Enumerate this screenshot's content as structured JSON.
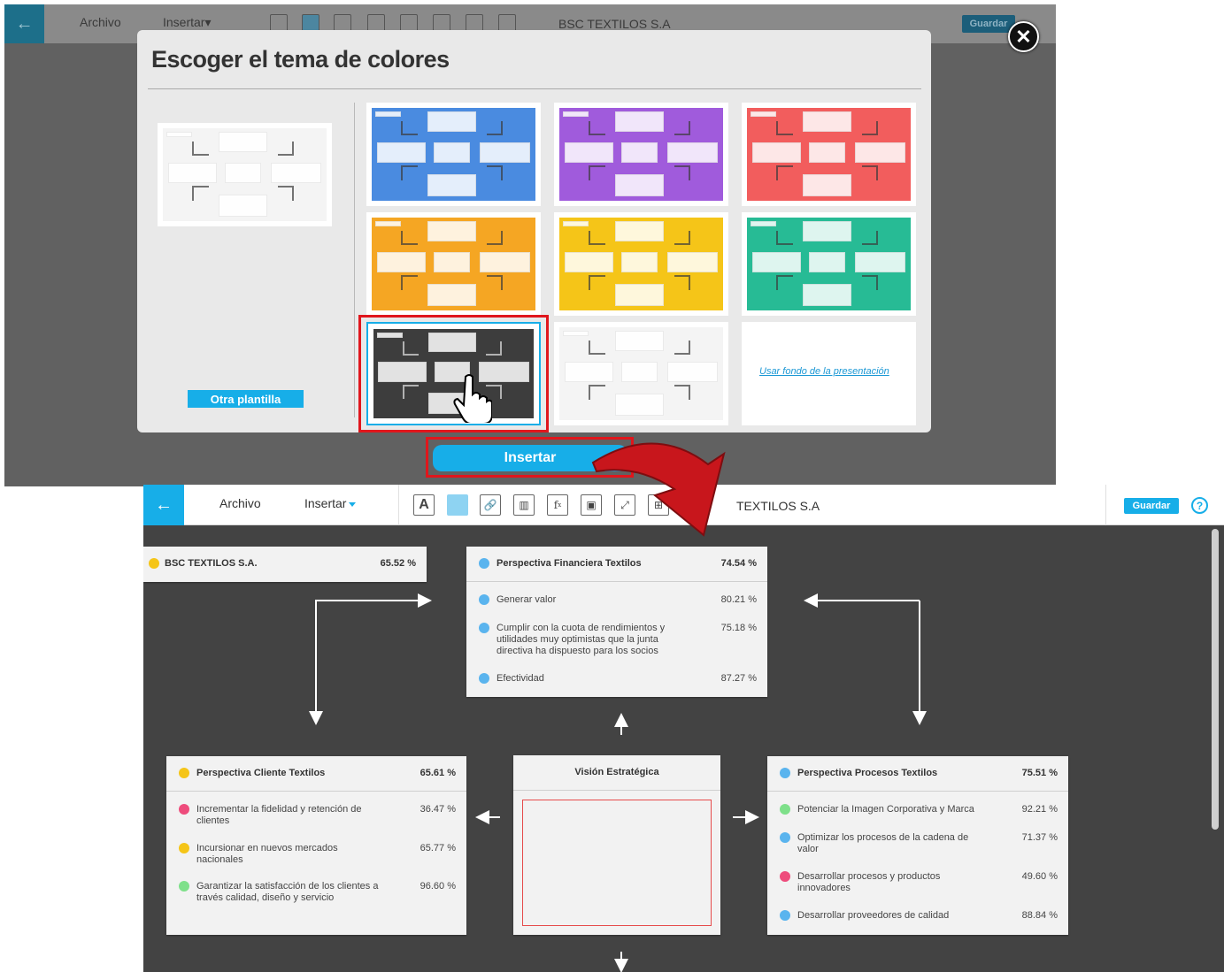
{
  "top_screen": {
    "toolbar": {
      "menu_archivo": "Archivo",
      "menu_insertar": "Insertar",
      "doc_title": "BSC TEXTILOS S.A",
      "guardar": "Guardar"
    },
    "dialog": {
      "title": "Escoger el tema de colores",
      "other_template_button": "Otra plantilla",
      "use_background_link": "Usar fondo de la presentación",
      "insert_button": "Insertar",
      "themes": [
        {
          "name": "default",
          "color": "#f4f4f4"
        },
        {
          "name": "blue",
          "color": "#4a8be0"
        },
        {
          "name": "purple",
          "color": "#a05bdc"
        },
        {
          "name": "red",
          "color": "#f25d5d"
        },
        {
          "name": "orange",
          "color": "#f5a623"
        },
        {
          "name": "yellow",
          "color": "#f5c518"
        },
        {
          "name": "teal",
          "color": "#27bb95"
        },
        {
          "name": "dark",
          "color": "#3d3d3d"
        },
        {
          "name": "light-gray",
          "color": "#f4f4f4"
        }
      ]
    }
  },
  "bottom_screen": {
    "toolbar": {
      "menu_archivo": "Archivo",
      "menu_insertar": "Insertar",
      "doc_title": "TEXTILOS S.A",
      "guardar": "Guardar",
      "help": "?"
    },
    "colors": {
      "yellow": "#f5c518",
      "blue": "#5ab4ee",
      "pink": "#ee4c7c",
      "green": "#7ee08a"
    },
    "bsc_card": {
      "title": "BSC TEXTILOS S.A.",
      "value": "65.52  %"
    },
    "financiera": {
      "title": "Perspectiva Financiera Textilos",
      "value": "74.54  %",
      "rows": [
        {
          "text": "Generar valor",
          "value": "80.21  %"
        },
        {
          "text": "Cumplir con la cuota de rendimientos y utilidades muy optimistas que la junta directiva ha dispuesto para los socios",
          "value": "75.18  %"
        },
        {
          "text": "Efectividad",
          "value": "87.27  %"
        }
      ]
    },
    "cliente": {
      "title": "Perspectiva Cliente Textilos",
      "value": "65.61  %",
      "rows": [
        {
          "text": "Incrementar la fidelidad y retención de clientes",
          "value": "36.47  %"
        },
        {
          "text": "Incursionar en nuevos mercados nacionales",
          "value": "65.77  %"
        },
        {
          "text": "Garantizar la satisfacción de los clientes a través calidad, diseño y servicio",
          "value": "96.60  %"
        }
      ]
    },
    "vision": {
      "title": "Visión Estratégica"
    },
    "procesos": {
      "title": "Perspectiva Procesos Textilos",
      "value": "75.51  %",
      "rows": [
        {
          "text": "Potenciar la Imagen Corporativa y Marca",
          "value": "92.21  %"
        },
        {
          "text": "Optimizar los procesos de la cadena de valor",
          "value": "71.37  %"
        },
        {
          "text": "Desarrollar procesos y productos innovadores",
          "value": "49.60  %"
        },
        {
          "text": "Desarrollar proveedores de calidad",
          "value": "88.84  %"
        }
      ]
    }
  }
}
